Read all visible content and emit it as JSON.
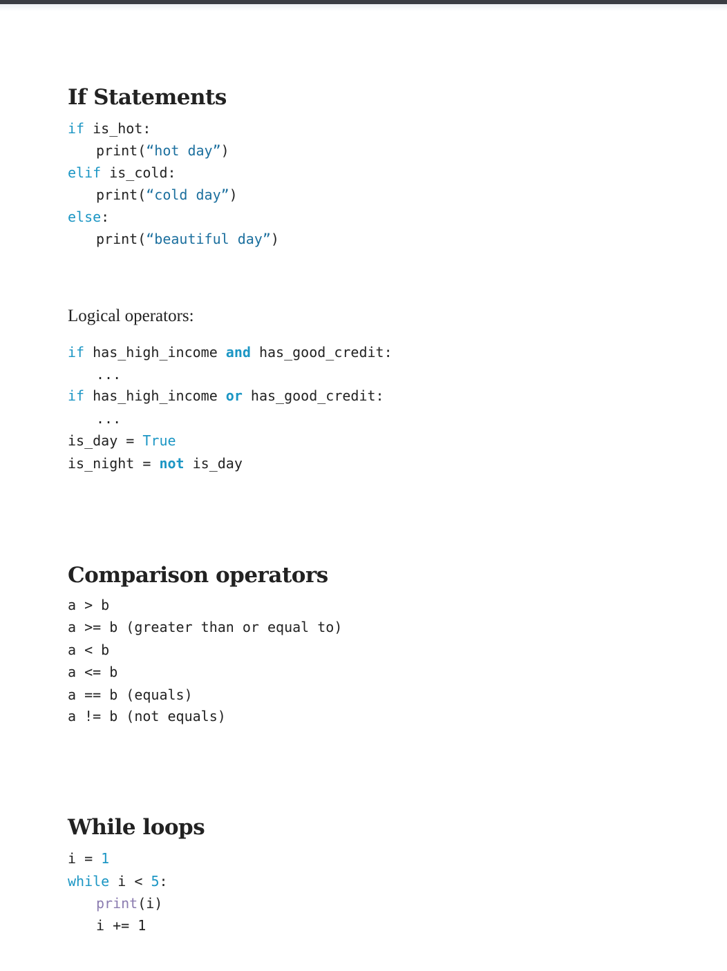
{
  "sections": {
    "if_statements": {
      "title": "If Statements",
      "lines": [
        {
          "kw": "if",
          "rest": " is_hot:"
        },
        {
          "fn": "print(",
          "str": "“hot day”",
          "end": ")"
        },
        {
          "kw": "elif",
          "rest": " is_cold:"
        },
        {
          "fn": "print(",
          "str": "“cold day”",
          "end": ")"
        },
        {
          "kw": "else",
          "rest": ":"
        },
        {
          "fn": "print(",
          "str": "“beautiful day”",
          "end": ")"
        }
      ]
    },
    "logical_operators": {
      "title": "Logical operators:",
      "line1": {
        "kw": "if",
        "a": " has_high_income ",
        "op": "and",
        "b": " has_good_credit:"
      },
      "ellipsis1": "...",
      "line2": {
        "kw": "if",
        "a": " has_high_income ",
        "op": "or",
        "b": " has_good_credit:"
      },
      "ellipsis2": "...",
      "line3": {
        "a": "is_day = ",
        "val": "True"
      },
      "line4": {
        "a": "is_night = ",
        "op": "not",
        "b": " is_day"
      }
    },
    "comparison_operators": {
      "title": "Comparison operators",
      "lines": [
        "a > b",
        "a >= b (greater than or equal to)",
        "a < b",
        "a <= b",
        "a == b (equals)",
        "a != b (not equals)"
      ]
    },
    "while_loops": {
      "title": "While loops",
      "line1": {
        "a": "i = ",
        "num": "1"
      },
      "line2": {
        "kw": "while",
        "a": " i < ",
        "num": "5",
        "b": ":"
      },
      "line3": {
        "fn": "print",
        "b": "(i)"
      },
      "line4": "i += 1"
    }
  }
}
